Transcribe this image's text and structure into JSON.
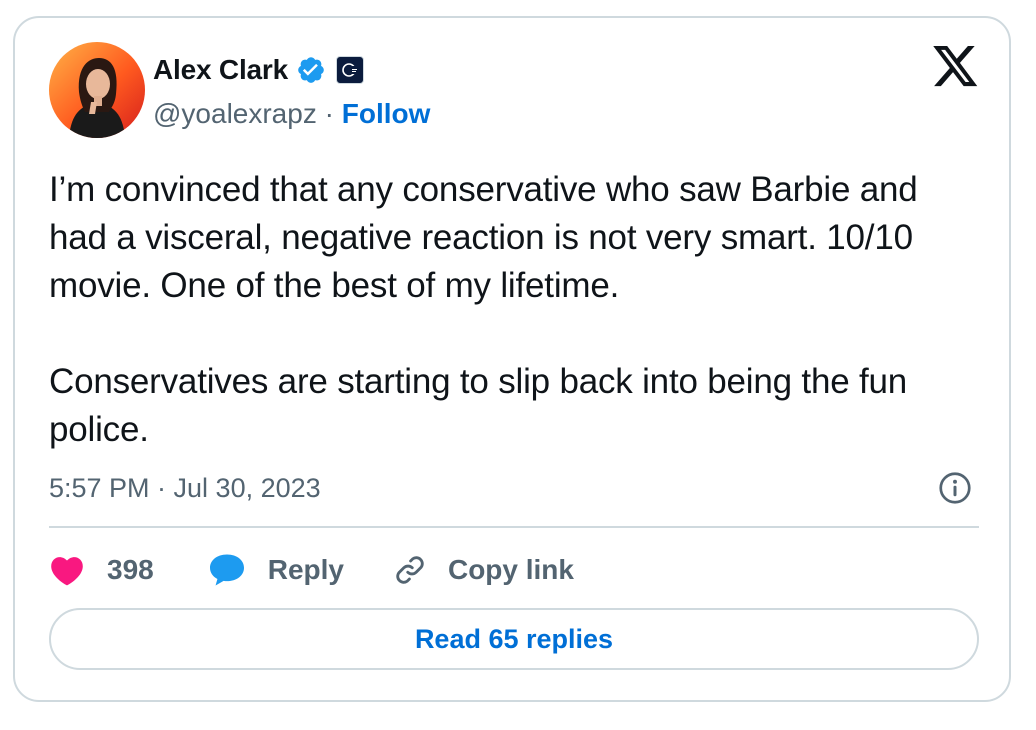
{
  "author": {
    "name": "Alex Clark",
    "handle": "@yoalexrapz",
    "separator": " · ",
    "follow_label": "Follow"
  },
  "tweet": {
    "paragraphs": [
      "I’m convinced that any conservative who saw Barbie and had a visceral, negative reaction is not very smart. 10/10 movie. One of the best of my lifetime.",
      "Conservatives are starting to slip back into being the fun police."
    ],
    "timestamp": "5:57 PM · Jul 30, 2023"
  },
  "actions": {
    "like_count": "398",
    "reply_label": "Reply",
    "copy_link_label": "Copy link"
  },
  "read_replies_label": "Read 65 replies",
  "colors": {
    "accent_blue": "#006fd6",
    "verified_blue": "#1d9bf0",
    "like_pink": "#f91880",
    "text_primary": "#0f1419",
    "text_secondary": "#536471",
    "border": "#cfd9de"
  },
  "icons": {
    "verified": "verified-badge-icon",
    "affiliation": "affiliation-badge-icon",
    "platform": "x-logo-icon",
    "info": "info-icon",
    "like": "heart-icon",
    "reply": "speech-bubble-icon",
    "copy_link": "link-icon"
  }
}
